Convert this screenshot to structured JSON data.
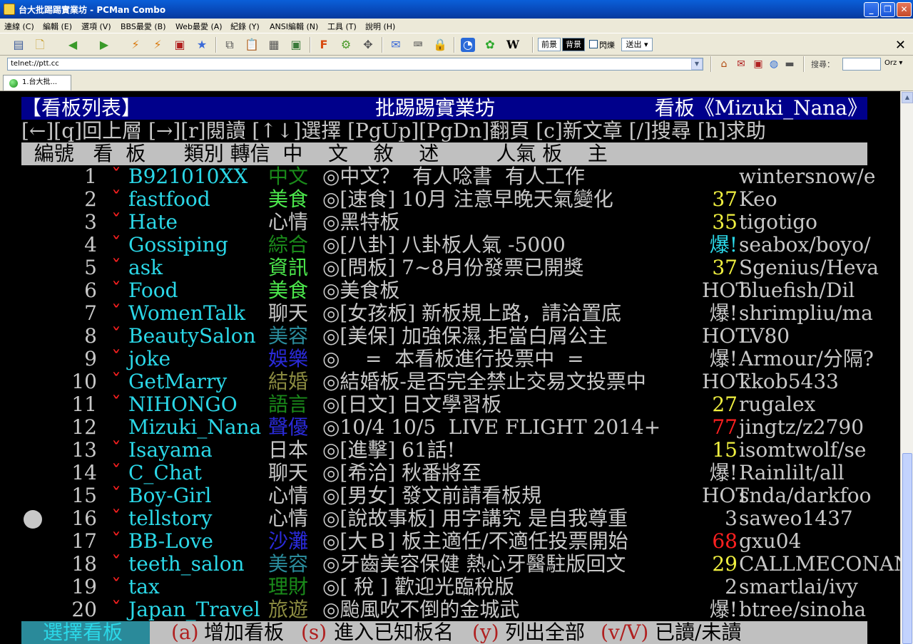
{
  "window": {
    "title": "台大批踢踢實業坊 - PCMan Combo"
  },
  "menu": [
    "連線 (C)",
    "編輯 (E)",
    "選項 (V)",
    "BBS最愛 (B)",
    "Web最愛 (A)",
    "紀錄 (Y)",
    "ANSI編輯 (N)",
    "工具 (T)",
    "說明 (H)"
  ],
  "toolbar": {
    "fg_label": "前景",
    "bg_label": "背景",
    "blink_label": "閃爍",
    "send_label": "送出",
    "icons": [
      "sitelist-icon",
      "new-connection-icon",
      "back-icon",
      "forward-icon",
      "reconnect-icon",
      "disconnect-icon",
      "stop-icon",
      "add-favorite-icon",
      "copy-icon",
      "paste-icon",
      "copy-ansi-icon",
      "screenshot-icon",
      "font-icon",
      "settings-icon",
      "fullscreen-icon",
      "send-icon",
      "encoding-icon",
      "lock-icon",
      "pcman-icon",
      "flower-icon",
      "wikipedia-icon"
    ]
  },
  "address": {
    "value": "telnet://ptt.cc"
  },
  "search": {
    "label": "搜尋：",
    "engine": "Orz"
  },
  "tab": {
    "label": "1.台大批..."
  },
  "terminal": {
    "header": {
      "left": "【看板列表】",
      "center": "批踢踢實業坊",
      "right": "看板《Mizuki_Nana》"
    },
    "help": "[←][q]回上層 [→][r]閱讀 [↑↓]選擇 [PgUp][PgDn]翻頁 [c]新文章 [/]搜尋 [h]求助",
    "columns": "  編號   看  板      類別 轉信  中    文    敘    述         人氣 板    主",
    "rows": [
      {
        "num": "1",
        "mark": "ˇ",
        "board": "B921010XX",
        "cat": "中文",
        "cat_color": "#1a8a1a",
        "desc": "◎中文？  有人唸書  有人工作",
        "pop": "",
        "pop_color": "#c8c8c8",
        "mod": "wintersnow/e"
      },
      {
        "num": "2",
        "mark": "ˇ",
        "board": "fastfood",
        "cat": "美食",
        "cat_color": "#4ce84c",
        "desc": "◎[速食] 10月 注意早晚天氣變化",
        "pop": "37",
        "pop_color": "#f0f040",
        "mod": "Keo"
      },
      {
        "num": "3",
        "mark": "ˇ",
        "board": "Hate",
        "cat": "心情",
        "cat_color": "#c8c8c8",
        "desc": "◎黑特板",
        "pop": "35",
        "pop_color": "#f0f040",
        "mod": "tigotigo"
      },
      {
        "num": "4",
        "mark": "ˇ",
        "board": "Gossiping",
        "cat": "綜合",
        "cat_color": "#1a8a1a",
        "desc": "◎[八卦] 八卦板人氣 -5000",
        "pop": "爆!",
        "pop_color": "#2bd8e8",
        "mod": "seabox/boyo/"
      },
      {
        "num": "5",
        "mark": "ˇ",
        "board": "ask",
        "cat": "資訊",
        "cat_color": "#4ce84c",
        "desc": "◎[問板] 7~8月份發票已開獎",
        "pop": "37",
        "pop_color": "#f0f040",
        "mod": "Sgenius/Heva"
      },
      {
        "num": "6",
        "mark": "ˇ",
        "board": "Food",
        "cat": "美食",
        "cat_color": "#4ce84c",
        "desc": "◎美食板",
        "pop": "HOT",
        "pop_color": "#c8c8c8",
        "mod": "bluefish/Dil"
      },
      {
        "num": "7",
        "mark": "ˇ",
        "board": "WomenTalk",
        "cat": "聊天",
        "cat_color": "#c8c8c8",
        "desc": "◎[女孩板] 新板規上路，請洽置底",
        "pop": "爆!",
        "pop_color": "#c8c8c8",
        "mod": "shrimpliu/ma"
      },
      {
        "num": "8",
        "mark": "ˇ",
        "board": "BeautySalon",
        "cat": "美容",
        "cat_color": "#2a8a9a",
        "desc": "◎[美保] 加強保濕,拒當白屑公主",
        "pop": "HOT",
        "pop_color": "#c8c8c8",
        "mod": "LV80"
      },
      {
        "num": "9",
        "mark": "ˇ",
        "board": "joke",
        "cat": "娛樂",
        "cat_color": "#2a2ad8",
        "desc": "◎    =  本看板進行投票中  =",
        "pop": "爆!",
        "pop_color": "#c8c8c8",
        "mod": "Armour/分隔?"
      },
      {
        "num": "10",
        "mark": "ˇ",
        "board": "GetMarry",
        "cat": "結婚",
        "cat_color": "#8a8a40",
        "desc": "◎結婚板-是否完全禁止交易文投票中",
        "pop": "HOT",
        "pop_color": "#c8c8c8",
        "mod": "kkob5433"
      },
      {
        "num": "11",
        "mark": "ˇ",
        "board": "NIHONGO",
        "cat": "語言",
        "cat_color": "#1a8a1a",
        "desc": "◎[日文] 日文學習板",
        "pop": "27",
        "pop_color": "#f0f040",
        "mod": "rugalex"
      },
      {
        "num": "12",
        "mark": "",
        "board": "Mizuki_Nana",
        "cat": "聲優",
        "cat_color": "#2a2ad8",
        "desc": "◎10/4 10/5  LIVE FLIGHT 2014+",
        "pop": "77",
        "pop_color": "#ff2020",
        "mod": "jingtz/z2790"
      },
      {
        "num": "13",
        "mark": "ˇ",
        "board": "Isayama",
        "cat": "日本",
        "cat_color": "#c8c8c8",
        "desc": "◎[進擊] 61話!",
        "pop": "15",
        "pop_color": "#f0f040",
        "mod": "isomtwolf/se"
      },
      {
        "num": "14",
        "mark": "ˇ",
        "board": "C_Chat",
        "cat": "聊天",
        "cat_color": "#c8c8c8",
        "desc": "◎[希洽] 秋番將至",
        "pop": "爆!",
        "pop_color": "#c8c8c8",
        "mod": "Rainlilt/all"
      },
      {
        "num": "15",
        "mark": "ˇ",
        "board": "Boy-Girl",
        "cat": "心情",
        "cat_color": "#c8c8c8",
        "desc": "◎[男女] 發文前請看板規",
        "pop": "HOT",
        "pop_color": "#c8c8c8",
        "mod": "snda/darkfoo"
      },
      {
        "num": "16",
        "mark": "ˇ",
        "board": "tellstory",
        "cat": "心情",
        "cat_color": "#c8c8c8",
        "desc": "◎[說故事板] 用字講究 是自我尊重",
        "pop": "3",
        "pop_color": "#c8c8c8",
        "mod": "saweo1437"
      },
      {
        "num": "17",
        "mark": "ˇ",
        "board": "BB-Love",
        "cat": "沙灘",
        "cat_color": "#2a2ad8",
        "desc": "◎[大Ｂ] 板主適任/不適任投票開始",
        "pop": "68",
        "pop_color": "#ff2020",
        "mod": "gxu04"
      },
      {
        "num": "18",
        "mark": "ˇ",
        "board": "teeth_salon",
        "cat": "美容",
        "cat_color": "#2a8a9a",
        "desc": "◎牙齒美容保健 熱心牙醫駐版回文",
        "pop": "29",
        "pop_color": "#f0f040",
        "mod": "CALLMECONAN/"
      },
      {
        "num": "19",
        "mark": "ˇ",
        "board": "tax",
        "cat": "理財",
        "cat_color": "#1a8a1a",
        "desc": "◎[ 稅 ] 歡迎光臨稅版",
        "pop": "2",
        "pop_color": "#c8c8c8",
        "mod": "smartlai/ivy"
      },
      {
        "num": "20",
        "mark": "ˇ",
        "board": "Japan_Travel",
        "cat": "旅遊",
        "cat_color": "#8a8a40",
        "desc": "◎颱風吹不倒的金城武",
        "pop": "爆!",
        "pop_color": "#c8c8c8",
        "mod": "btree/sinoha"
      }
    ],
    "status": {
      "mode": "選擇看板",
      "k1": "(a)",
      "t1": "增加看板",
      "k2": "(s)",
      "t2": "進入已知板名",
      "k3": "(y)",
      "t3": "列出全部",
      "k4": "(v/V)",
      "t4": "已讀/未讀"
    }
  }
}
